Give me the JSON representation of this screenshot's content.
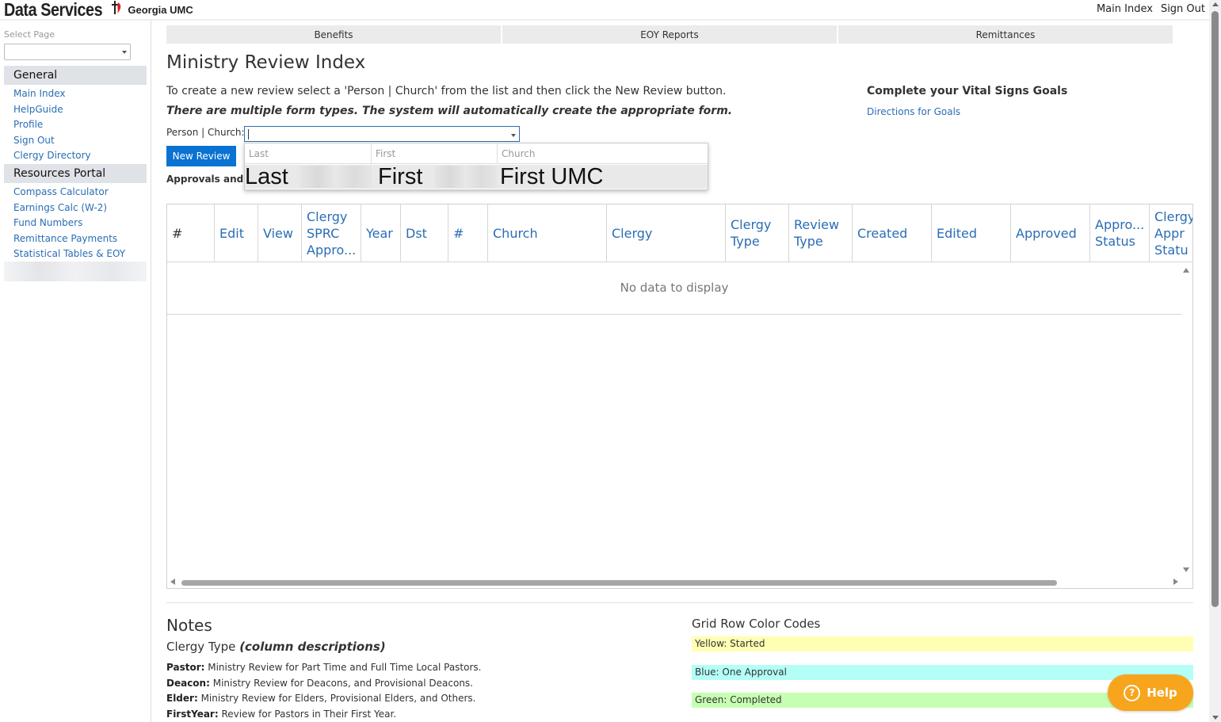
{
  "header": {
    "app_title": "Data Services",
    "org_name": "Georgia UMC",
    "logo_icon": "cross-flame-icon",
    "links": [
      "Main Index",
      "Sign Out"
    ]
  },
  "sidebar": {
    "select_page_label": "Select Page",
    "sections": [
      {
        "title": "General",
        "items": [
          "Main Index",
          "HelpGuide",
          "Profile",
          "Sign Out",
          "Clergy Directory"
        ]
      },
      {
        "title": "Resources Portal",
        "items": [
          "Compass Calculator",
          "Earnings Calc (W-2)",
          "Fund Numbers",
          "Remittance Payments",
          "Statistical Tables & EOY"
        ]
      }
    ]
  },
  "tabs": [
    "Benefits",
    "EOY Reports",
    "Remittances"
  ],
  "main": {
    "title": "Ministry Review Index",
    "intro_line1": "To create a new review select a 'Person | Church' from the list and then click the New Review button.",
    "intro_line2": "There are multiple form types. The system will automatically create the appropriate form.",
    "person_church_label": "Person | Church:",
    "new_review_label": "New Review",
    "approvals_label": "Approvals and E",
    "vital_signs_title": "Complete your Vital Signs Goals",
    "vital_signs_link": "Directions for Goals"
  },
  "dropdown": {
    "columns": [
      "Last",
      "First",
      "Church"
    ],
    "row": {
      "last": "Last",
      "first": "First",
      "church": "First UMC"
    }
  },
  "grid": {
    "columns": [
      "#",
      "Edit",
      "View",
      "Clergy SPRC Appro...",
      "Year",
      "Dst",
      "#",
      "Church",
      "Clergy",
      "Clergy Type",
      "Review Type",
      "Created",
      "Edited",
      "Approved",
      "Appro... Status",
      "Clergy Appr Statu"
    ],
    "empty_text": "No data to display"
  },
  "notes": {
    "title": "Notes",
    "clergy_type_title": "Clergy Type",
    "clergy_type_subtitle": "(column descriptions)",
    "items": [
      {
        "term": "Pastor:",
        "desc": " Ministry Review for Part Time and Full Time Local Pastors."
      },
      {
        "term": "Deacon:",
        "desc": " Ministry Review for Deacons, and Provisional Deacons."
      },
      {
        "term": "Elder:",
        "desc": " Ministry Review for Elders, Provisional Elders, and Others."
      },
      {
        "term": "FirstYear:",
        "desc": " Review for Pastors in Their First Year."
      }
    ]
  },
  "color_codes": {
    "title": "Grid Row Color Codes",
    "items": [
      {
        "label": "Yellow: Started",
        "color": "#ffffb3"
      },
      {
        "label": "Blue: One Approval",
        "color": "#b3fff7"
      },
      {
        "label": "Green: Completed",
        "color": "#c6ffb3"
      }
    ]
  },
  "help_button": {
    "label": "Help",
    "icon": "question-circle-icon",
    "color": "#f7a51c"
  },
  "colors": {
    "accent": "#0a72d2",
    "link": "#2a6db5"
  }
}
